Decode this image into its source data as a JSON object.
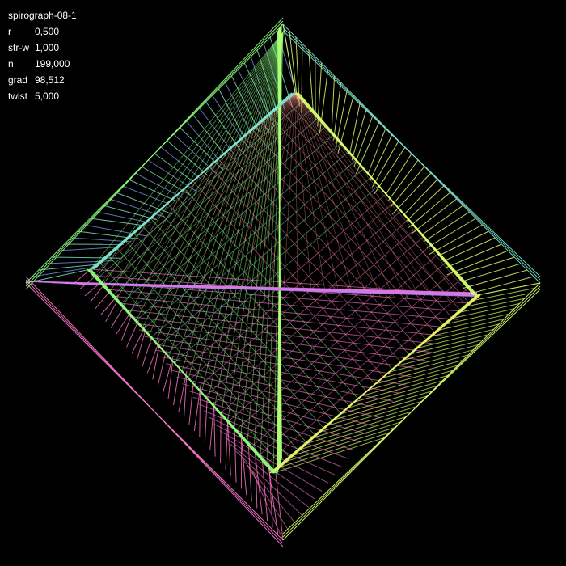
{
  "title": "spirograph-08-1",
  "params": [
    {
      "label": "r",
      "value": "0,500"
    },
    {
      "label": "str-w",
      "value": "1,000"
    },
    {
      "label": "n",
      "value": "199,000"
    },
    {
      "label": "grad",
      "value": "98,512"
    },
    {
      "label": "twist",
      "value": "5,000"
    }
  ],
  "colors": {
    "background": "#000000",
    "text": "#ffffff",
    "blue": "#6f95d6",
    "cyan": "#7fe6d0",
    "green": "#8cff7a",
    "lime": "#d8ff6e",
    "yellow": "#e6f56a",
    "pink": "#ff7ad0",
    "magenta": "#ff6fb0",
    "violet": "#b07aff",
    "salmon": "#ff8a8a"
  }
}
